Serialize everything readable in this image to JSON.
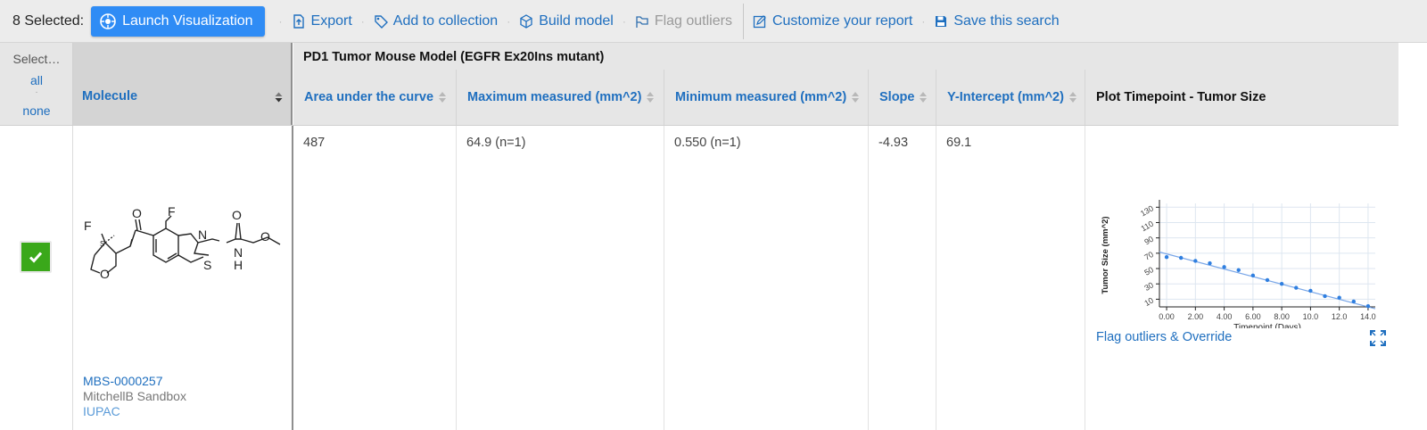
{
  "toolbar": {
    "selected_count": "8 Selected:",
    "launch": "Launch Visualization",
    "export": "Export",
    "add_collection": "Add to collection",
    "build_model": "Build model",
    "flag_outliers": "Flag outliers",
    "customize": "Customize your report",
    "save_search": "Save this search"
  },
  "select_col": {
    "label": "Select…",
    "all": "all",
    "dot": "·",
    "none": "none"
  },
  "molecule_col": {
    "header": "Molecule"
  },
  "group_header": "PD1 Tumor Mouse Model (EGFR Ex20Ins mutant)",
  "columns": {
    "auc": "Area under the curve",
    "max": "Maximum measured (mm^2)",
    "min": "Minimum measured (mm^2)",
    "slope": "Slope",
    "yint": "Y-Intercept (mm^2)",
    "plot": "Plot Timepoint - Tumor Size"
  },
  "row": {
    "auc": "487",
    "max": "64.9 (n=1)",
    "min": "0.550 (n=1)",
    "slope": "-4.93",
    "yint": "69.1",
    "mol_id": "MBS-0000257",
    "project": "MitchellB Sandbox",
    "iupac": "IUPAC",
    "flag_override": "Flag outliers & Override",
    "structure_labels": {
      "F1": "F",
      "S": "S",
      "O_ring": "O",
      "O_ketone": "O",
      "F2": "F",
      "N": "N",
      "S_thiazole": "S",
      "O_carb": "O",
      "NH_N": "N",
      "NH_H": "H",
      "O_methyl": "O"
    }
  },
  "chart_data": {
    "type": "scatter",
    "title": "",
    "xlabel": "Timepoint (Days)",
    "ylabel": "Tumor Size (mm^2)",
    "xlim": [
      -0.5,
      14.5
    ],
    "ylim": [
      0,
      135
    ],
    "x_ticks": [
      "0.00",
      "2.00",
      "4.00",
      "6.00",
      "8.00",
      "10.0",
      "12.0",
      "14.0"
    ],
    "y_ticks": [
      "10",
      "30",
      "50",
      "70",
      "90",
      "110",
      "130"
    ],
    "points_x": [
      0,
      1,
      2,
      3,
      4,
      5,
      6,
      7,
      8,
      9,
      10,
      11,
      12,
      13,
      14
    ],
    "points_y": [
      64.9,
      64,
      60,
      57,
      52,
      48,
      41,
      35,
      30,
      25,
      21,
      14,
      12,
      7,
      1
    ],
    "fit": {
      "slope": -4.93,
      "intercept": 69.1,
      "color": "#7aa7e8"
    },
    "point_color": "#2f7fe0",
    "grid": true
  },
  "colors": {
    "accent": "#2f8cf5",
    "link": "#1f6fbf",
    "checkbox": "#3aa81a"
  }
}
